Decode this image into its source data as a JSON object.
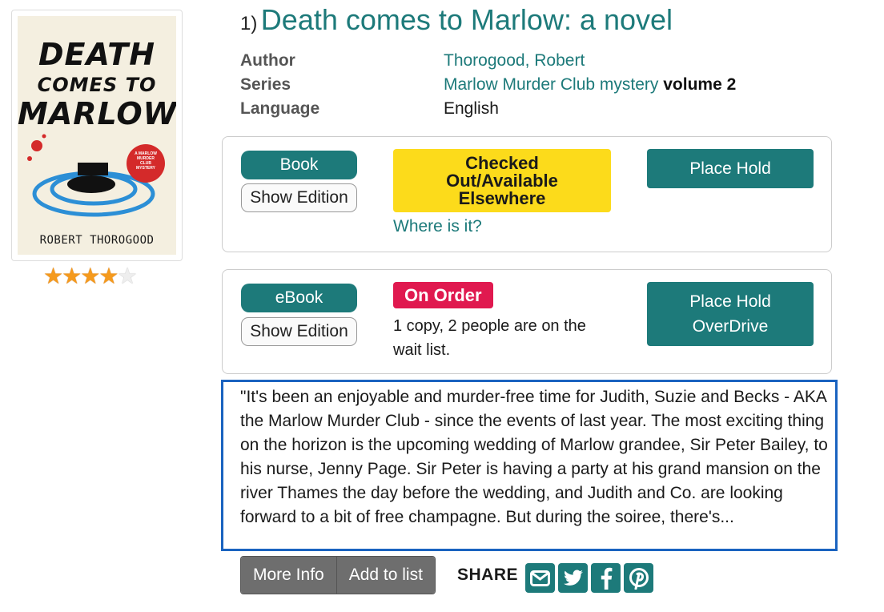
{
  "result_number": "1)",
  "title": "Death comes to Marlow: a novel",
  "cover": {
    "line1": "DEATH",
    "line2": "COMES TO",
    "line3": "MARLOW",
    "author": "ROBERT THOROGOOD",
    "badge": "A MARLOW MURDER CLUB MYSTERY"
  },
  "rating": {
    "value": 4,
    "max": 5,
    "on_color": "#f59a1d"
  },
  "meta": {
    "author_label": "Author",
    "author_value": "Thorogood, Robert",
    "series_label": "Series",
    "series_value": "Marlow Murder Club mystery",
    "series_volume": "volume 2",
    "language_label": "Language",
    "language_value": "English"
  },
  "formats": [
    {
      "format": "Book",
      "edition_button": "Show Edition",
      "status": "Checked Out/Available Elsewhere",
      "where_link": "Where is it?",
      "hold_button": "Place Hold"
    },
    {
      "format": "eBook",
      "edition_button": "Show Edition",
      "status": "On Order",
      "wait_text": "1 copy, 2 people are on the wait list.",
      "hold_button_line1": "Place Hold",
      "hold_button_line2": "OverDrive"
    }
  ],
  "description": "\"It's been an enjoyable and murder-free time for Judith, Suzie and Becks - AKA the Marlow Murder Club - since the events of last year. The most exciting thing on the horizon is the upcoming wedding of Marlow grandee, Sir Peter Bailey, to his nurse, Jenny Page. Sir Peter is having a party at his grand mansion on the river Thames the day before the wedding, and Judith and Co. are looking forward to a bit of free champagne. But during the soiree, there's...",
  "actions": {
    "more_info": "More Info",
    "add_to_list": "Add to list"
  },
  "share": {
    "label": "SHARE",
    "icons": [
      "email-icon",
      "twitter-icon",
      "facebook-icon",
      "pinterest-icon"
    ]
  },
  "colors": {
    "teal": "#1d7a7a",
    "yellow": "#fcdb1b",
    "on_order": "#e0194f",
    "highlight_border": "#1a63c0"
  }
}
